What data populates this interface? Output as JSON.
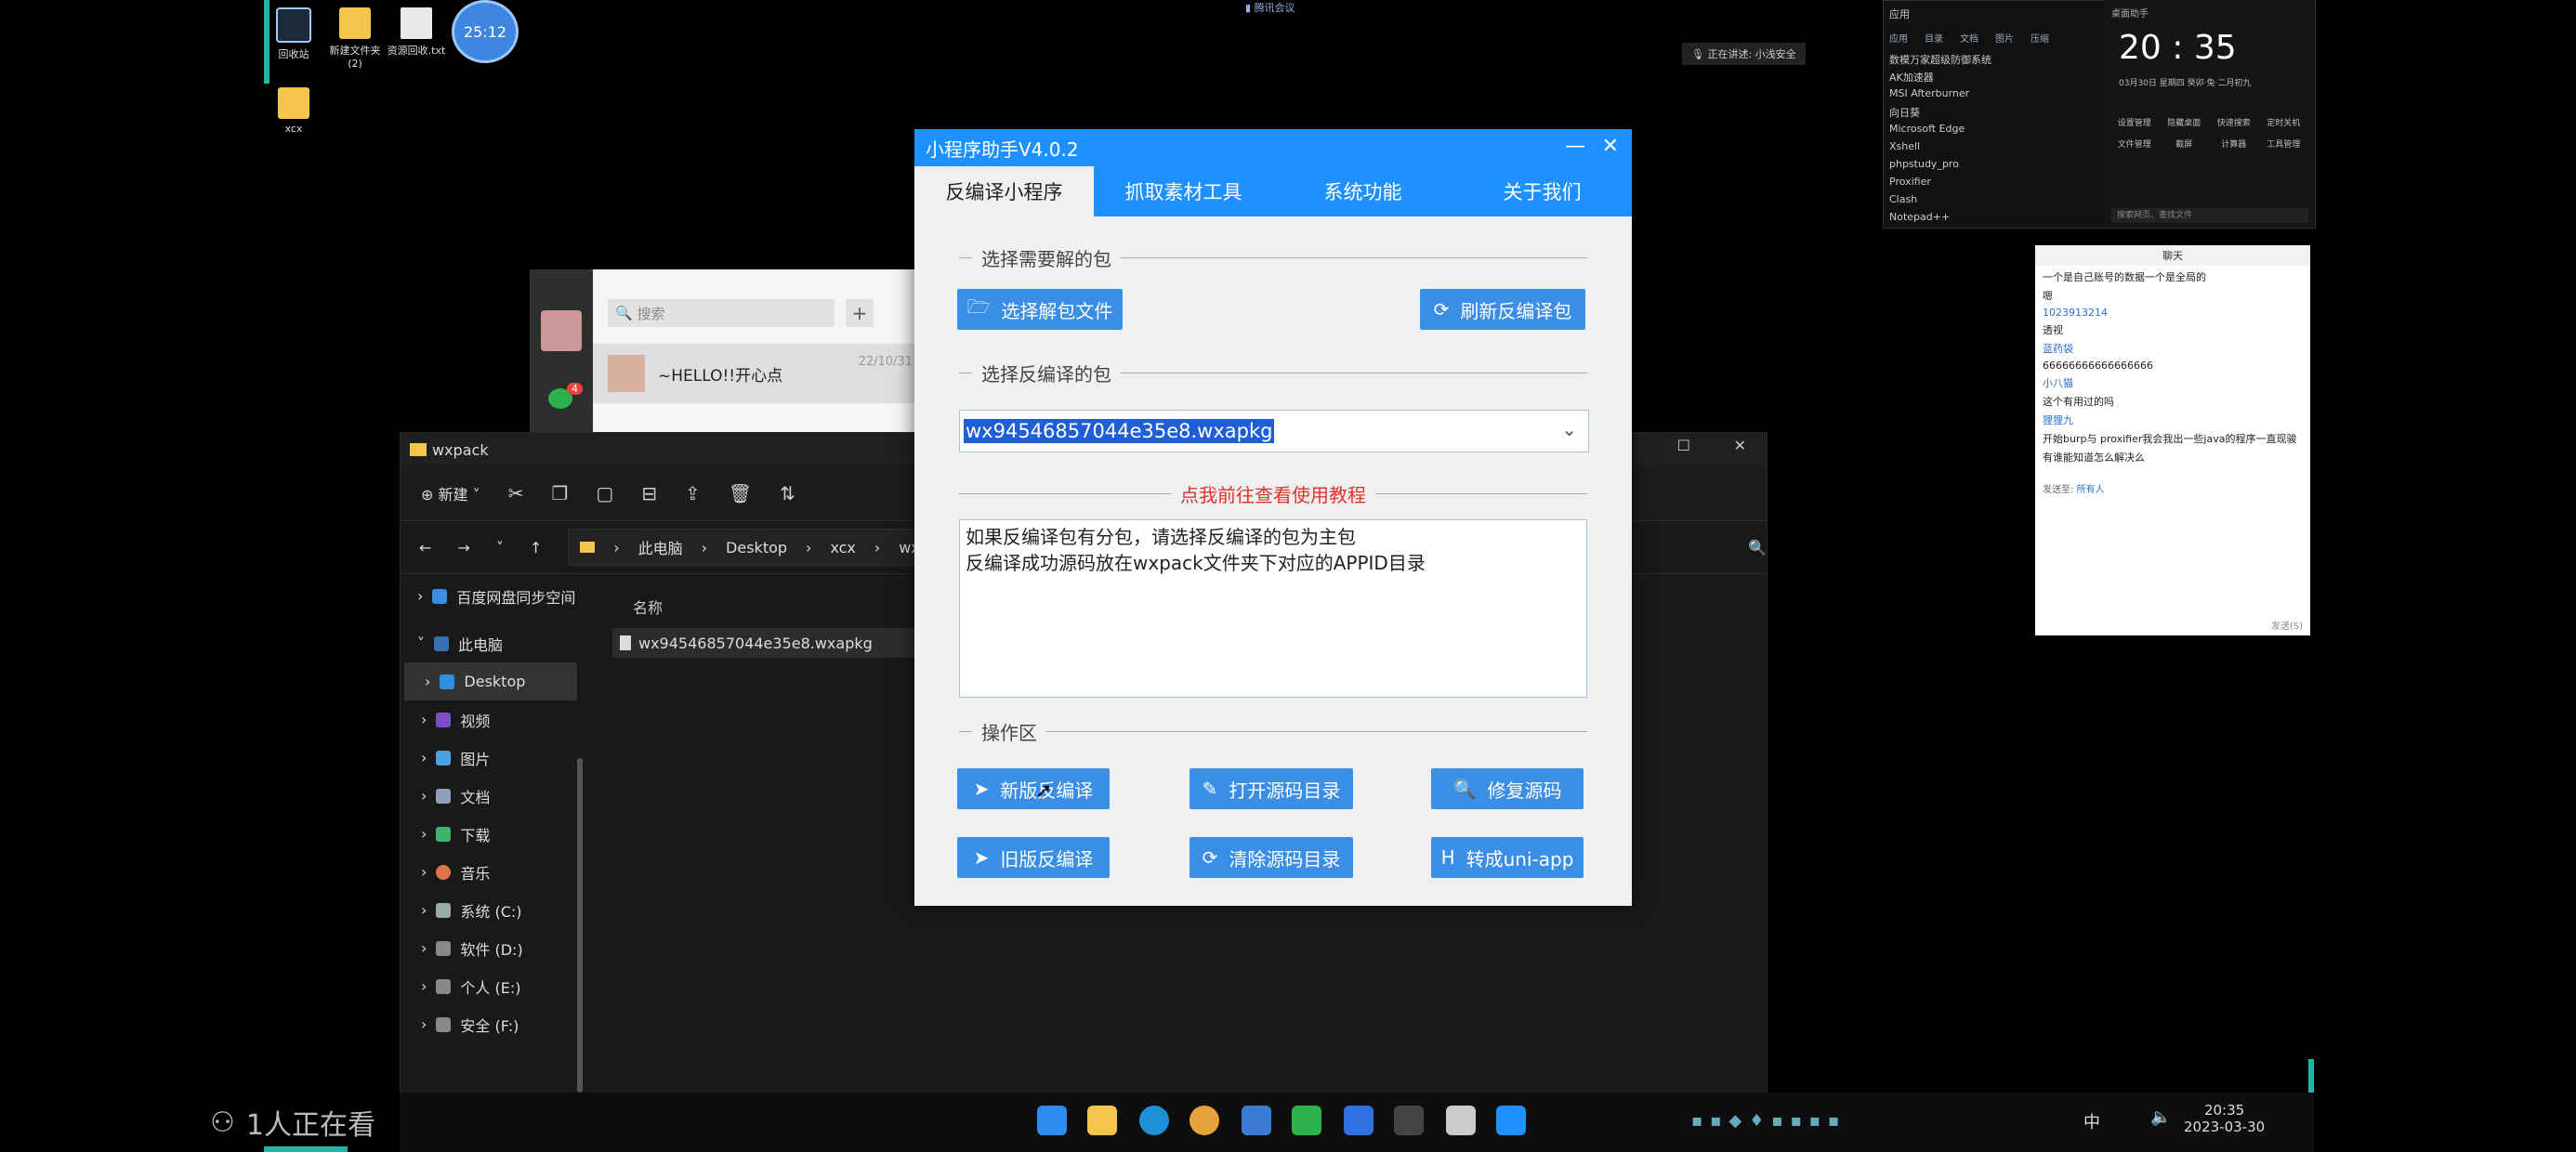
{
  "desktop": {
    "icons": [
      {
        "label": "回收站"
      },
      {
        "label": "新建文件夹\n(2)"
      },
      {
        "label": "资源回收.txt"
      },
      {
        "label": "xcx"
      }
    ],
    "timer": "25:12",
    "top_status": "腾讯会议",
    "share_notice": "正在讲述: 小浅安全"
  },
  "wechat": {
    "search_placeholder": "搜索",
    "add": "+",
    "badge": "4",
    "chat_name": "~HELLO!!开心点",
    "chat_date": "22/10/31"
  },
  "explorer": {
    "title": "wxpack",
    "new_label": "新建",
    "breadcrumb": [
      "此电脑",
      "Desktop",
      "xcx",
      "wxpack"
    ],
    "column_name": "名称",
    "files": [
      "wx94546857044e35e8.wxapkg"
    ],
    "nav": [
      {
        "label": "百度网盘同步空间"
      },
      {
        "label": "此电脑"
      },
      {
        "label": "Desktop"
      },
      {
        "label": "视频"
      },
      {
        "label": "图片"
      },
      {
        "label": "文档"
      },
      {
        "label": "下载"
      },
      {
        "label": "音乐"
      },
      {
        "label": "系统 (C:)"
      },
      {
        "label": "软件 (D:)"
      },
      {
        "label": "个人 (E:)"
      },
      {
        "label": "安全 (F:)"
      }
    ]
  },
  "dialog": {
    "title": "小程序助手V4.0.2",
    "minimize": "—",
    "close": "✕",
    "tabs": [
      "反编译小程序",
      "抓取素材工具",
      "系统功能",
      "关于我们"
    ],
    "section_select_pkg": "选择需要解的包",
    "btn_select_file": "选择解包文件",
    "btn_refresh": "刷新反编译包",
    "section_decompile_pkg": "选择反编译的包",
    "selected_pkg": "wx94546857044e35e8.wxapkg",
    "tutorial_link": "点我前往查看使用教程",
    "info_lines": [
      "如果反编译包有分包，请选择反编译的包为主包",
      "反编译成功源码放在wxpack文件夹下对应的APPID目录"
    ],
    "section_ops": "操作区",
    "btn_new_decompile": "新版反编译",
    "btn_open_src": "打开源码目录",
    "btn_fix_src": "修复源码",
    "btn_old_decompile": "旧版反编译",
    "btn_clear_src": "清除源码目录",
    "btn_uniapp": "转成uni-app"
  },
  "start_panel": {
    "header_left": "应用",
    "header_right": "桌面助手",
    "tabs": [
      "应用",
      "目录",
      "文档",
      "图片",
      "压缩"
    ],
    "apps": [
      "数模万家超级防御系统",
      "AK加速器",
      "MSI Afterburner",
      "向日葵",
      "Microsoft Edge",
      "Xshell",
      "phpstudy_pro",
      "Proxifier",
      "Clash",
      "Notepad++"
    ],
    "clock": "20 : 35",
    "date_line": "03月30日   星期四   癸卯·兔·二月初九",
    "tools": [
      "设置管理",
      "隐藏桌面",
      "快速搜索",
      "定时关机",
      "文件管理",
      "截屏",
      "计算器",
      "工具管理"
    ],
    "search_placeholder": "搜索网页、查找文件"
  },
  "qq_chat": {
    "title": "聊天",
    "messages": [
      "一个是自己账号的数据一个是全局的",
      "嗯",
      "1023913214",
      "透视",
      "蓝药袋",
      "66666666666666666",
      "小八猫",
      "这个有用过的吗",
      "狸狸九",
      "开始burp与 proxifier我会我出一些java的程序一直现骏",
      "有谁能知道怎么解决么"
    ],
    "send_to": "发送至:",
    "all_people": "所有人",
    "send": "发送(S)"
  },
  "taskbar": {
    "time": "20:35",
    "date": "2023-03-30",
    "ime": "中"
  },
  "live": {
    "watching": "1人正在看"
  }
}
